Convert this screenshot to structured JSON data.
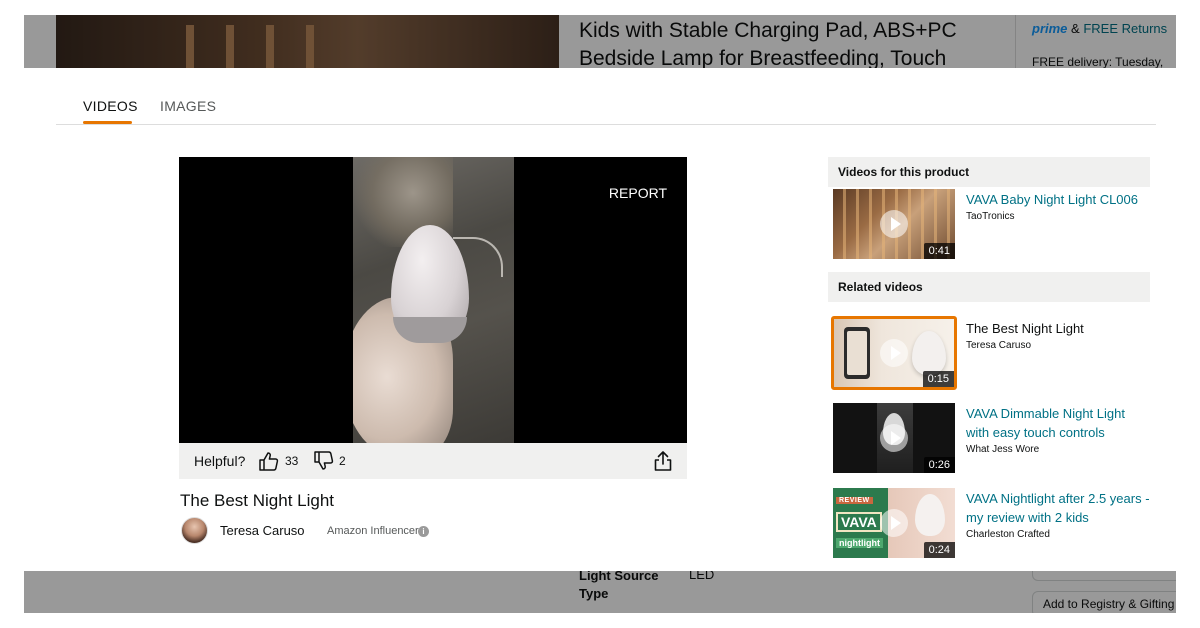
{
  "background_page": {
    "product_title_line1": "Kids with Stable Charging Pad, ABS+PC",
    "product_title_line2": "Bedside Lamp for Breastfeeding, Touch",
    "prime": "prime",
    "prime_amp": "&",
    "free_returns": "FREE Returns",
    "delivery": "FREE delivery: Tuesday,",
    "spec_label": "Light Source Type",
    "spec_value": "LED",
    "registry_button": "Add to Registry & Gifting"
  },
  "tabs": [
    {
      "label": "VIDEOS",
      "active": true
    },
    {
      "label": "IMAGES",
      "active": false
    }
  ],
  "player": {
    "report_label": "REPORT",
    "helpful_label": "Helpful?",
    "thumbs_up_count": "33",
    "thumbs_down_count": "2",
    "title": "The Best Night Light",
    "author": "Teresa Caruso",
    "author_role": "Amazon Influencer",
    "info_glyph": "i"
  },
  "product_videos": {
    "header": "Videos for this product",
    "items": [
      {
        "title": "VAVA Baby Night Light CL006",
        "author": "TaoTronics",
        "duration": "0:41"
      }
    ]
  },
  "related_videos": {
    "header": "Related videos",
    "items": [
      {
        "title": "The Best Night Light",
        "author": "Teresa Caruso",
        "duration": "0:15",
        "selected": true
      },
      {
        "title": "VAVA Dimmable Night Light with easy touch controls",
        "author": "What Jess Wore",
        "duration": "0:26",
        "selected": false
      },
      {
        "title": "VAVA Nightlight after 2.5 years - my review with 2 kids",
        "author": "Charleston Crafted",
        "duration": "0:24",
        "selected": false
      }
    ]
  },
  "thumbnail_text": {
    "review": "REVIEW",
    "vava": "VAVA",
    "nightlight": "nightlight"
  },
  "colors": {
    "accent_orange": "#e77600",
    "link_teal": "#007185",
    "panel_gray": "#f0f0ef"
  }
}
